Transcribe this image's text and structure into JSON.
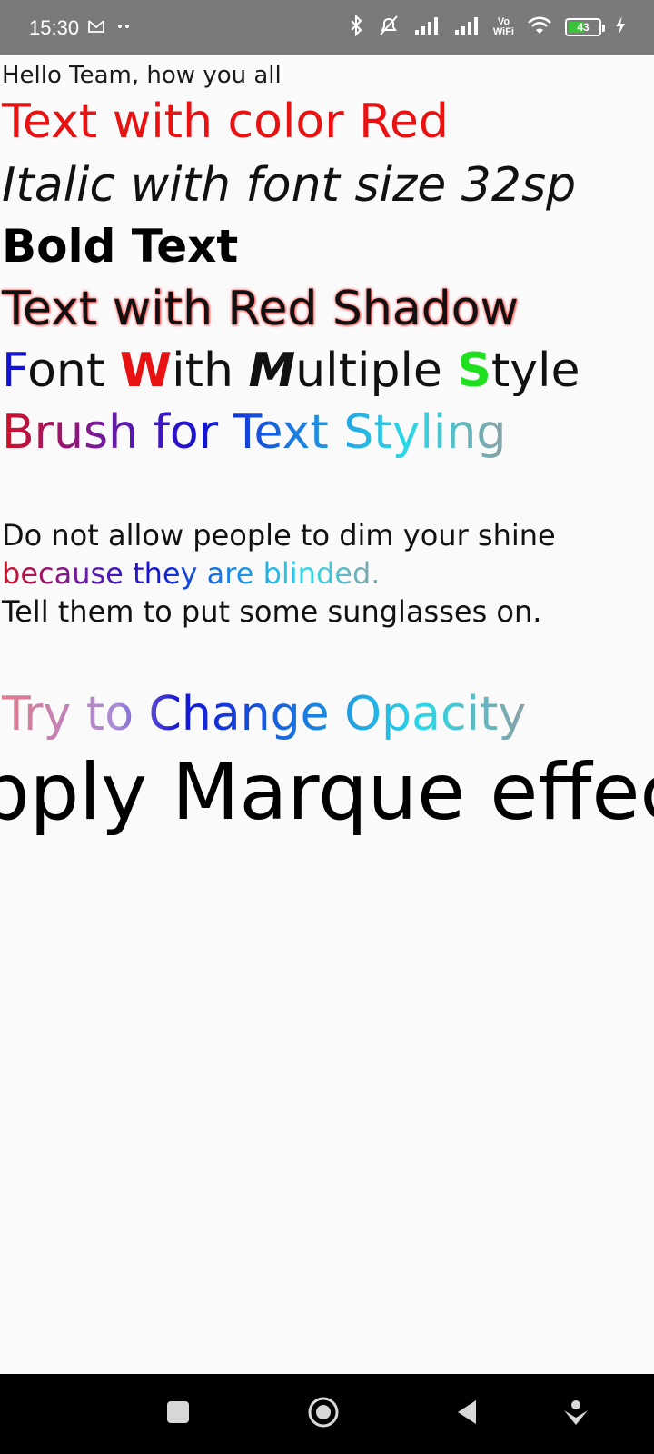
{
  "status_bar": {
    "time": "15:30",
    "battery": "43",
    "icons": [
      "gmail-icon",
      "more-dots-icon",
      "bluetooth-icon",
      "mute-icon",
      "signal-icon",
      "signal-icon",
      "vowifi-icon",
      "wifi-icon",
      "battery-icon",
      "charging-icon"
    ],
    "vowifi_top": "Vo",
    "vowifi_bottom": "WiFi"
  },
  "content": {
    "greeting": "Hello Team, how you all",
    "red_text": "Text with color Red",
    "italic_text": "Italic with font size 32sp",
    "bold_text": "Bold Text",
    "shadow_text": "Text with Red Shadow",
    "multi_style": {
      "p1": "F",
      "p2": "ont ",
      "p3": "W",
      "p4": "ith ",
      "p5": "M",
      "p6": "ultiple ",
      "p7": "S",
      "p8": "tyle"
    },
    "brush_text": "Brush for Text Styling",
    "quote_line1": "Do not allow people to dim your shine",
    "quote_line2": "because they are blinded.",
    "quote_line3": "Tell them to put some sunglasses on.",
    "opacity_text": "Try to Change Opacity",
    "marquee_text": "pply Marque effect"
  },
  "colors": {
    "red": "#e81212",
    "blue": "#1212d6",
    "green": "#1ee01e",
    "statusbar": "#7a7a7a",
    "background": "#fafafa"
  },
  "navigation": {
    "buttons": [
      "recents-button",
      "home-button",
      "back-button",
      "assistant-button"
    ]
  }
}
